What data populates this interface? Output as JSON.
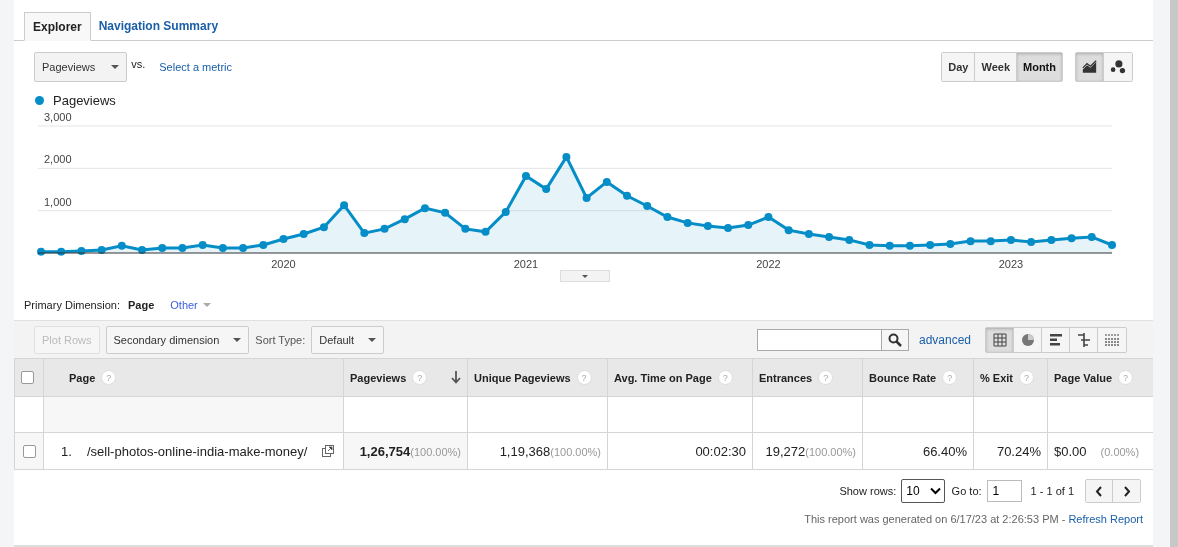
{
  "tabs": [
    {
      "label": "Explorer",
      "selected": true
    },
    {
      "label": "Navigation Summary",
      "selected": false
    }
  ],
  "metric_selector": {
    "value": "Pageviews"
  },
  "vs_label": "vs.",
  "select_metric": "Select a metric",
  "period_buttons": [
    {
      "label": "Day",
      "selected": false
    },
    {
      "label": "Week",
      "selected": false
    },
    {
      "label": "Month",
      "selected": true
    }
  ],
  "chart_type_buttons": [
    {
      "kind": "line",
      "selected": true
    },
    {
      "kind": "motion",
      "selected": false
    }
  ],
  "chart_data": {
    "type": "area",
    "ylim": [
      0,
      3000
    ],
    "yticks": [
      {
        "value": 1000,
        "label": "1,000"
      },
      {
        "value": 2000,
        "label": "2,000"
      },
      {
        "value": 3000,
        "label": "3,000"
      }
    ],
    "xticks": [
      {
        "value": 2020,
        "label": "2020"
      },
      {
        "value": 2021,
        "label": "2021"
      },
      {
        "value": 2022,
        "label": "2022"
      },
      {
        "value": 2023,
        "label": "2023"
      }
    ],
    "xlim": [
      2019,
      2023.4167
    ],
    "x": [
      2019,
      2019.0833,
      2019.1667,
      2019.25,
      2019.3333,
      2019.4167,
      2019.5,
      2019.5833,
      2019.6667,
      2019.75,
      2019.8333,
      2019.9167,
      2020,
      2020.0833,
      2020.1667,
      2020.25,
      2020.3333,
      2020.4167,
      2020.5,
      2020.5833,
      2020.6667,
      2020.75,
      2020.8333,
      2020.9167,
      2021,
      2021.0833,
      2021.1667,
      2021.25,
      2021.3333,
      2021.4167,
      2021.5,
      2021.5833,
      2021.6667,
      2021.75,
      2021.8333,
      2021.9167,
      2022,
      2022.0833,
      2022.1667,
      2022.25,
      2022.3333,
      2022.4167,
      2022.5,
      2022.5833,
      2022.6667,
      2022.75,
      2022.8333,
      2022.9167,
      2023,
      2023.0833,
      2023.1667,
      2023.25,
      2023.3333,
      2023.4167
    ],
    "series": [
      {
        "name": "Pageviews",
        "color": "#058dc7",
        "values": [
          30,
          30,
          50,
          70,
          170,
          70,
          120,
          120,
          190,
          120,
          120,
          190,
          330,
          450,
          610,
          1130,
          470,
          570,
          800,
          1060,
          950,
          570,
          500,
          970,
          1820,
          1510,
          2270,
          1300,
          1680,
          1350,
          1110,
          850,
          710,
          640,
          590,
          660,
          850,
          540,
          450,
          380,
          310,
          190,
          170,
          170,
          190,
          210,
          280,
          280,
          310,
          260,
          310,
          350,
          380,
          190
        ]
      }
    ]
  },
  "primary_dimension": {
    "label": "Primary Dimension:",
    "value": "Page",
    "other": "Other"
  },
  "toolbar": {
    "plot_rows": {
      "label": "Plot Rows",
      "disabled": true
    },
    "secondary_dimension": "Secondary dimension",
    "sort_type_label": "Sort Type:",
    "sort_type": "Default",
    "advanced": "advanced",
    "view_buttons": [
      {
        "kind": "table",
        "selected": true
      },
      {
        "kind": "pie",
        "selected": false
      },
      {
        "kind": "bars",
        "selected": false
      },
      {
        "kind": "comparison",
        "selected": false
      },
      {
        "kind": "pivot",
        "selected": false
      }
    ]
  },
  "table": {
    "select_all_checked": false,
    "columns": [
      {
        "label": "Page",
        "help": "?",
        "sorted": false
      },
      {
        "label": "Pageviews",
        "help": "?",
        "sorted": true
      },
      {
        "label": "Unique Pageviews",
        "help": "?",
        "sorted": false
      },
      {
        "label": "Avg. Time on Page",
        "help": "?",
        "sorted": false
      },
      {
        "label": "Entrances",
        "help": "?",
        "sorted": false
      },
      {
        "label": "Bounce Rate",
        "help": "?",
        "sorted": false
      },
      {
        "label": "% Exit",
        "help": "?",
        "sorted": false
      },
      {
        "label": "Page Value",
        "help": "?",
        "sorted": false
      }
    ],
    "rows": [
      {
        "checked": false,
        "cells": [
          {
            "index": "1.",
            "value": "/sell-photos-online-india-make-money/"
          },
          {
            "value": "1,26,754",
            "share": "(100.00%)"
          },
          {
            "value": "1,19,368",
            "share": "(100.00%)"
          },
          {
            "value": "00:02:30"
          },
          {
            "value": "19,272",
            "share": "(100.00%)"
          },
          {
            "value": "66.40%"
          },
          {
            "value": "70.24%"
          },
          {
            "value": "$0.00",
            "share": "(0.00%)"
          }
        ]
      }
    ]
  },
  "pagination": {
    "show_rows_label": "Show rows:",
    "show_rows": "10",
    "goto_label": "Go to:",
    "goto": "1",
    "range": "1 - 1 of 1"
  },
  "footer": {
    "text": "This report was generated on 6/17/23 at 2:26:53 PM - ",
    "link": "Refresh Report"
  }
}
